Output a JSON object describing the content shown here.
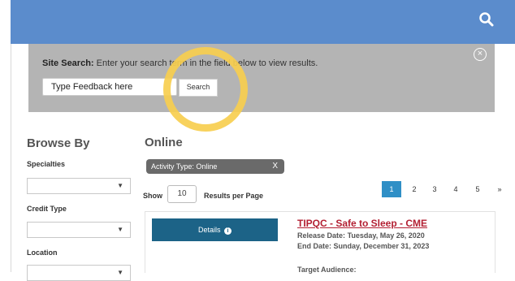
{
  "header": {
    "search_icon": "search-icon"
  },
  "site_search": {
    "label": "Site Search:",
    "instructions": "Enter your search term in the field below to view results.",
    "input_value": "Type Feedback here",
    "button_label": "Search",
    "close_icon": "close-circle-icon"
  },
  "browse": {
    "title": "Browse By",
    "filters": [
      {
        "label": "Specialties",
        "selected": ""
      },
      {
        "label": "Credit Type",
        "selected": ""
      },
      {
        "label": "Location",
        "selected": ""
      }
    ]
  },
  "listing": {
    "title": "Online",
    "active_filter": "Activity Type: Online",
    "active_filter_remove": "X",
    "show_label": "Show",
    "per_page_value": "10",
    "per_page_label": "Results per Page",
    "pages": [
      "1",
      "2",
      "3",
      "4",
      "5"
    ],
    "next_label": "»",
    "active_page": "1"
  },
  "course": {
    "details_label": "Details",
    "title": "TIPQC - Safe to Sleep - CME",
    "release_label": "Release Date:",
    "release_date": "Tuesday, May 26, 2020",
    "end_label": "End Date:",
    "end_date": "Sunday, December 31, 2023",
    "audience_label": "Target Audience:"
  },
  "colors": {
    "header_blue": "#5b8ccc",
    "search_panel_gray": "#b4b4b4",
    "highlight_yellow": "#f7ce4f",
    "pager_active": "#2f8fc6",
    "details_button": "#1c6387",
    "course_title_red": "#b32033"
  }
}
